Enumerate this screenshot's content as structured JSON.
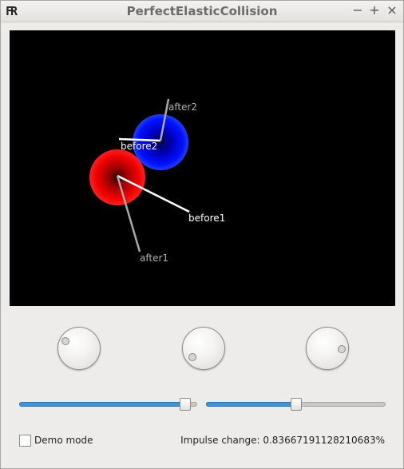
{
  "window": {
    "title": "PerfectElasticCollision",
    "app_icon": "FR",
    "controls": {
      "minimize": "−",
      "maximize": "+",
      "close": "×"
    }
  },
  "scene": {
    "labels": {
      "before1": "before1",
      "after1": "after1",
      "before2": "before2",
      "after2": "after2"
    },
    "colors": {
      "background": "#000000",
      "ball1": "#ff0000",
      "ball2": "#0000ff",
      "before_line": "#ffffff",
      "after_line": "#a0a0a0"
    }
  },
  "controls": {
    "dials": [
      {
        "name": "dial-1"
      },
      {
        "name": "dial-2"
      },
      {
        "name": "dial-3"
      }
    ],
    "sliders": [
      {
        "name": "slider-1",
        "value": 0.96
      },
      {
        "name": "slider-2",
        "value": 0.5
      }
    ]
  },
  "footer": {
    "demo_mode_label": "Demo mode",
    "demo_mode_checked": false,
    "impulse_text": "Impulse change: 0.83667191128210683%"
  }
}
